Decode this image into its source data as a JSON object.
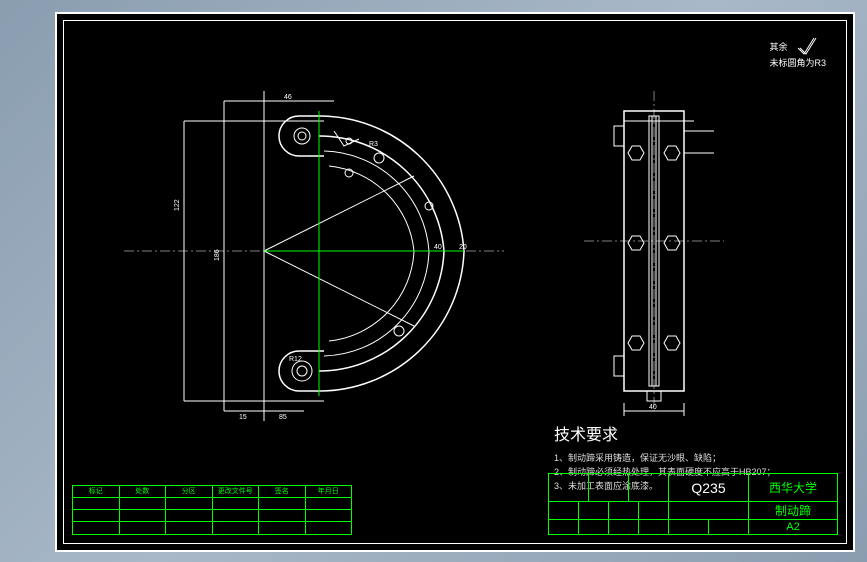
{
  "surface_note": {
    "label": "其余",
    "spec": "未标圆角为R3"
  },
  "tech_requirements": {
    "title": "技术要求",
    "items": [
      "1、制动蹄采用铸造，保证无沙眼、缺陷；",
      "2、制动蹄必须经热处理，其表面硬度不应高于HB207；",
      "3、未加工表面应涂底漆。"
    ]
  },
  "title_block": {
    "material": "Q235",
    "university": "西华大学",
    "part_name": "制动蹄",
    "sheet": "A2"
  },
  "dimensions": {
    "main": {
      "d1": "46",
      "d2": "85",
      "d3": "40",
      "d4": "15",
      "d5": "122",
      "d6": "186",
      "d7": "85",
      "d8": "20",
      "r1": "R3",
      "r2": "R12"
    },
    "side": {
      "w": "40"
    }
  },
  "revision_headers": [
    "标记",
    "处数",
    "分区",
    "更改文件号",
    "签名",
    "年月日"
  ]
}
